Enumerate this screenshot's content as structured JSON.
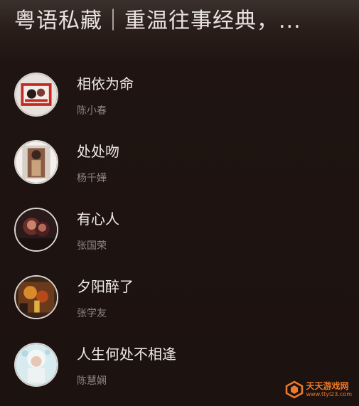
{
  "header": {
    "title": "粤语私藏｜重温往事经典，..."
  },
  "songs": [
    {
      "title": "相依为命",
      "artist": "陈小春",
      "cover_icon": "album-cover-1"
    },
    {
      "title": "处处吻",
      "artist": "杨千嬅",
      "cover_icon": "album-cover-2"
    },
    {
      "title": "有心人",
      "artist": "张国荣",
      "cover_icon": "album-cover-3"
    },
    {
      "title": "夕阳醉了",
      "artist": "张学友",
      "cover_icon": "album-cover-4"
    },
    {
      "title": "人生何处不相逢",
      "artist": "陈慧娴",
      "cover_icon": "album-cover-5"
    }
  ],
  "watermark": {
    "name": "天天游戏网",
    "url": "www.ttyl23.com"
  },
  "colors": {
    "background": "#1d1210",
    "title_text": "#f0ebe8",
    "artist_text": "#8f8682",
    "watermark": "#f07a2a"
  }
}
